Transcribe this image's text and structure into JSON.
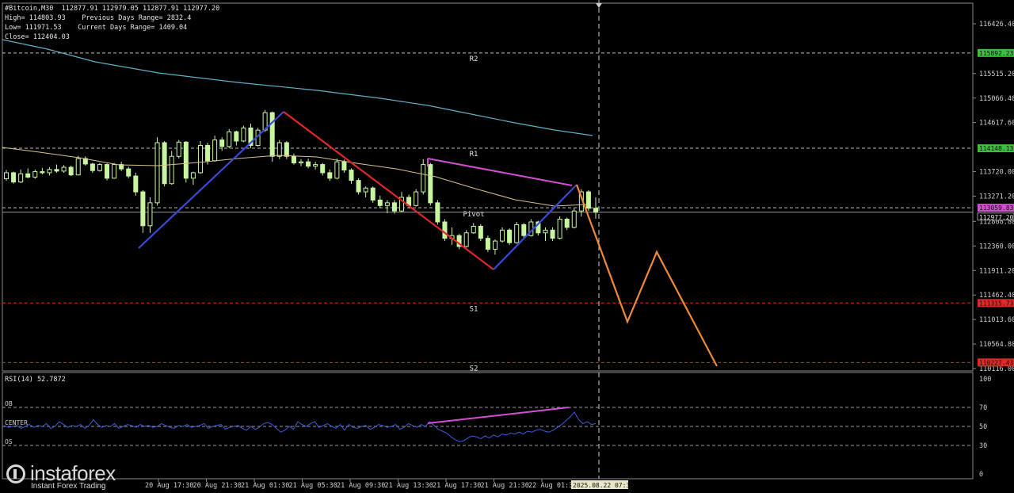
{
  "header": {
    "line1": "#Bitcoin,M30  112877.91 112979.05 112877.91 112977.20",
    "line2": "High= 114803.93    Previous Days Range= 2832.4",
    "line3": "Low= 111971.53    Current Days Range= 1409.04",
    "line4": "Close= 112404.03"
  },
  "logo": {
    "name": "instaforex",
    "tagline": "Instant Forex Trading"
  },
  "colors": {
    "background": "#000000",
    "bull_candle": "#c8f5a0",
    "ma_long": "#5fb0c8",
    "ma_short": "#d8c48a",
    "zigzag_up": "#3a4ad8",
    "zigzag_down": "#e02828",
    "divergence": "#d24fd2",
    "forecast": "#ee8a3a",
    "resistance_level": "#cfcfcf",
    "support_level": "#e02828",
    "rsi_line": "#3d5ad8"
  },
  "chart_data": {
    "type": "candlestick",
    "symbol": "#Bitcoin",
    "timeframe": "M30",
    "ohlc_last": {
      "open": 112877.91,
      "high": 112979.05,
      "low": 112877.91,
      "close": 112977.2
    },
    "y_ticks": [
      "116426.40",
      "115515.20",
      "115066.40",
      "114617.60",
      "113720.00",
      "113271.20",
      "112808.80",
      "112360.00",
      "111911.20",
      "111462.40",
      "111013.60",
      "110564.80",
      "110116.00"
    ],
    "ylim": [
      110116.0,
      116426.4
    ],
    "x_ticks": [
      "20 Aug 17:30",
      "20 Aug 21:30",
      "21 Aug 01:30",
      "21 Aug 05:30",
      "21 Aug 09:30",
      "21 Aug 13:30",
      "21 Aug 17:30",
      "21 Aug 21:30",
      "22 Aug 01:30"
    ],
    "time_cursor": "2025.08.22 07:30",
    "levels": [
      {
        "name": "R2",
        "price_label": "115892.23",
        "value": 115892.23,
        "kind": "resistance"
      },
      {
        "name": "R1",
        "price_label": "114148.13",
        "value": 114148.13,
        "kind": "resistance"
      },
      {
        "name": "Pivot",
        "price_label": "113059.83",
        "value": 113059.83,
        "kind": "pivot"
      },
      {
        "name": "S1",
        "price_label": "111315.73",
        "value": 111315.73,
        "kind": "support"
      },
      {
        "name": "S2",
        "price_label": "110227.43",
        "value": 110227.43,
        "kind": "support"
      }
    ],
    "current_price_label": "112977.20",
    "current_price": 112977.2,
    "rsi": {
      "label": "RSI(14) 52.7872",
      "ticks": [
        "100",
        "70",
        "50",
        "30",
        "0"
      ],
      "levels": [
        {
          "name": "OB",
          "value": 70
        },
        {
          "name": "CENTER",
          "value": 50
        },
        {
          "name": "OS",
          "value": 30
        }
      ],
      "values": [
        51,
        49,
        50,
        51,
        48,
        50,
        52,
        49,
        51,
        50,
        53,
        48,
        50,
        55,
        52,
        49,
        51,
        50,
        52,
        48,
        51,
        57,
        52,
        49,
        51,
        50,
        53,
        48,
        50,
        52,
        51,
        49,
        52,
        50,
        51,
        49,
        50,
        53,
        51,
        49,
        48,
        51,
        50,
        52,
        49,
        50,
        51,
        53,
        48,
        50,
        51,
        52,
        47,
        49,
        50,
        51,
        48,
        46,
        50,
        47,
        49,
        53,
        54,
        52,
        48,
        44,
        46,
        50,
        47,
        55,
        52,
        50,
        53,
        55,
        49,
        51,
        53,
        50,
        48,
        52,
        46,
        52,
        49,
        48,
        50,
        51,
        47,
        49,
        52,
        51,
        49,
        50,
        52,
        47,
        49,
        53,
        51,
        49,
        52,
        50,
        55,
        51,
        47,
        45,
        43,
        39,
        36,
        34,
        35,
        38,
        40,
        39,
        37,
        40,
        38,
        41,
        39,
        42,
        41,
        43,
        42,
        44,
        42,
        45,
        44,
        46,
        47,
        45,
        44,
        46,
        49,
        52,
        56,
        60,
        65,
        57,
        53,
        55,
        52,
        53
      ]
    },
    "candles": [
      [
        113590,
        113750,
        113550,
        113700
      ],
      [
        113700,
        113720,
        113500,
        113530
      ],
      [
        113530,
        113760,
        113510,
        113680
      ],
      [
        113680,
        113780,
        113600,
        113620
      ],
      [
        113620,
        113760,
        113590,
        113720
      ],
      [
        113720,
        113790,
        113670,
        113700
      ],
      [
        113700,
        113800,
        113650,
        113760
      ],
      [
        113760,
        113850,
        113700,
        113730
      ],
      [
        113730,
        113840,
        113700,
        113800
      ],
      [
        113800,
        113830,
        113640,
        113660
      ],
      [
        113660,
        114010,
        113650,
        113960
      ],
      [
        113960,
        114000,
        113830,
        113860
      ],
      [
        113860,
        113880,
        113700,
        113740
      ],
      [
        113740,
        113880,
        113720,
        113850
      ],
      [
        113850,
        113870,
        113560,
        113600
      ],
      [
        113600,
        113880,
        113590,
        113850
      ],
      [
        113850,
        113900,
        113730,
        113770
      ],
      [
        113770,
        113810,
        113600,
        113640
      ],
      [
        113640,
        113700,
        113280,
        113350
      ],
      [
        113350,
        113380,
        112600,
        112730
      ],
      [
        112730,
        113250,
        112600,
        113150
      ],
      [
        113150,
        114350,
        113100,
        114250
      ],
      [
        114250,
        114280,
        113450,
        113500
      ],
      [
        113500,
        114100,
        113480,
        114000
      ],
      [
        114000,
        114300,
        113960,
        114260
      ],
      [
        114260,
        114280,
        113520,
        113600
      ],
      [
        113600,
        113720,
        113480,
        113700
      ],
      [
        113700,
        114280,
        113680,
        114200
      ],
      [
        114200,
        114250,
        113850,
        113920
      ],
      [
        113920,
        114380,
        113900,
        114300
      ],
      [
        114300,
        114350,
        114100,
        114180
      ],
      [
        114180,
        114500,
        114150,
        114450
      ],
      [
        114450,
        114470,
        114200,
        114280
      ],
      [
        114280,
        114560,
        114260,
        114520
      ],
      [
        114520,
        114600,
        114150,
        114200
      ],
      [
        114200,
        114520,
        114180,
        114480
      ],
      [
        114480,
        114850,
        114450,
        114800
      ],
      [
        114800,
        114820,
        113900,
        114000
      ],
      [
        114000,
        114300,
        113950,
        114250
      ],
      [
        114250,
        114280,
        113950,
        114000
      ],
      [
        114000,
        114050,
        113850,
        113880
      ],
      [
        113880,
        113950,
        113820,
        113900
      ],
      [
        113900,
        113960,
        113780,
        113820
      ],
      [
        113820,
        113900,
        113760,
        113850
      ],
      [
        113850,
        113880,
        113650,
        113700
      ],
      [
        113700,
        113760,
        113550,
        113600
      ],
      [
        113600,
        113960,
        113580,
        113900
      ],
      [
        113900,
        113940,
        113700,
        113750
      ],
      [
        113750,
        113780,
        113500,
        113560
      ],
      [
        113560,
        113600,
        113300,
        113350
      ],
      [
        113350,
        113450,
        113250,
        113420
      ],
      [
        113420,
        113450,
        113150,
        113200
      ],
      [
        113200,
        113280,
        113050,
        113100
      ],
      [
        113100,
        113200,
        112960,
        113150
      ],
      [
        113150,
        113200,
        112950,
        113000
      ],
      [
        113000,
        113350,
        112980,
        113250
      ],
      [
        113250,
        113300,
        113050,
        113100
      ],
      [
        113100,
        113400,
        113080,
        113350
      ],
      [
        113350,
        113950,
        113300,
        113850
      ],
      [
        113850,
        113880,
        113100,
        113150
      ],
      [
        113150,
        113200,
        112750,
        112800
      ],
      [
        112800,
        112850,
        112450,
        112500
      ],
      [
        112500,
        112700,
        112380,
        112550
      ],
      [
        112550,
        112580,
        112300,
        112350
      ],
      [
        112350,
        112650,
        112330,
        112600
      ],
      [
        112600,
        112780,
        112580,
        112720
      ],
      [
        112720,
        112760,
        112450,
        112500
      ],
      [
        112500,
        112550,
        112250,
        112300
      ],
      [
        112300,
        112480,
        112200,
        112450
      ],
      [
        112450,
        112700,
        112420,
        112650
      ],
      [
        112650,
        112680,
        112380,
        112420
      ],
      [
        112420,
        112800,
        112400,
        112750
      ],
      [
        112750,
        112780,
        112500,
        112550
      ],
      [
        112550,
        112850,
        112530,
        112800
      ],
      [
        112800,
        112820,
        112550,
        112600
      ],
      [
        112600,
        112700,
        112450,
        112650
      ],
      [
        112650,
        112700,
        112450,
        112500
      ],
      [
        112500,
        112900,
        112480,
        112850
      ],
      [
        112850,
        112880,
        112650,
        112700
      ],
      [
        112700,
        113050,
        112680,
        113000
      ],
      [
        113000,
        113400,
        112900,
        113350
      ],
      [
        113350,
        113380,
        113000,
        113050
      ],
      [
        113050,
        113250,
        112860,
        112978
      ]
    ]
  }
}
